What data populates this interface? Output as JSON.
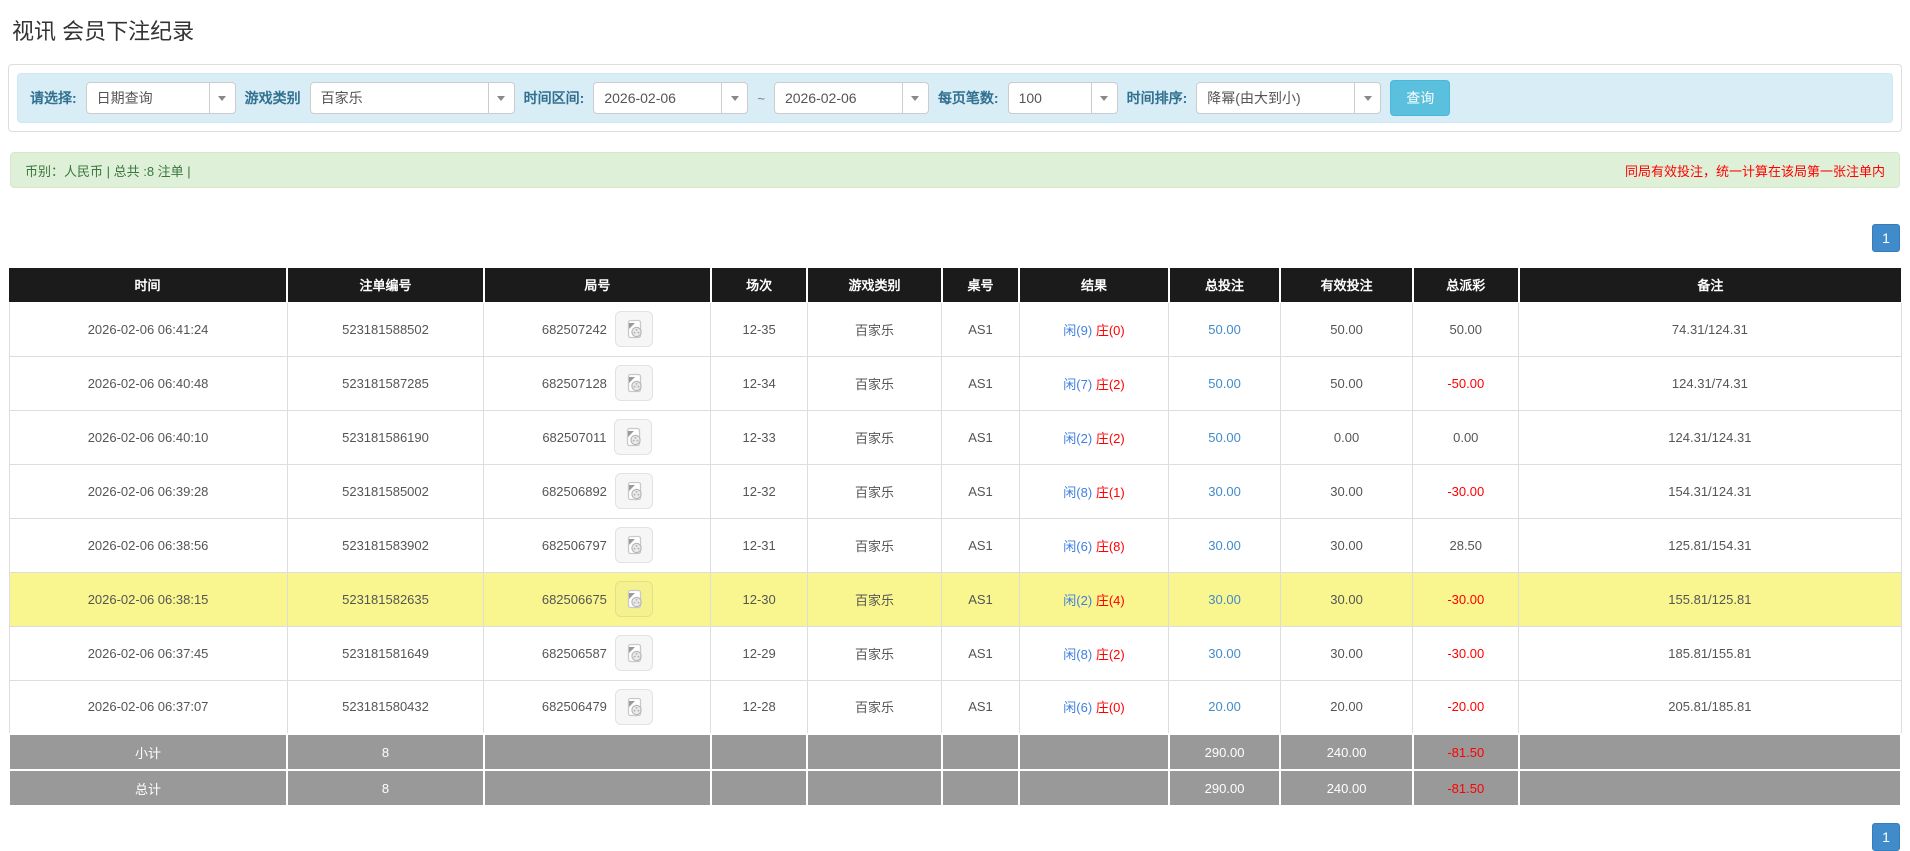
{
  "page": {
    "title": "视讯 会员下注纪录"
  },
  "filters": {
    "select_label": "请选择:",
    "select_value": "日期查询",
    "game_type_label": "游戏类别",
    "game_type_value": "百家乐",
    "date_range_label": "时间区间:",
    "date_from": "2026-02-06",
    "date_separator": "~",
    "date_to": "2026-02-06",
    "page_size_label": "每页笔数:",
    "page_size_value": "100",
    "sort_label": "时间排序:",
    "sort_value": "降幂(由大到小)",
    "search_button": "查询"
  },
  "alert_bar": {
    "left_text": "币别：人民币 | 总共 :8 注单 |",
    "right_text": "同局有效投注，统一计算在该局第一张注单内"
  },
  "pagination": {
    "page": "1"
  },
  "colors": {
    "accent_blue": "#428bca",
    "button_blue": "#5bc0de",
    "player_blue": "#3e7fe0",
    "loss_red": "#ff0000",
    "highlight_yellow": "#f9f690",
    "summary_gray": "#999999",
    "header_black": "#1b1b1b",
    "alert_green_bg": "#dff0d8",
    "filter_blue_bg": "#d9edf7"
  },
  "table": {
    "headers": [
      "时间",
      "注单编号",
      "局号",
      "场次",
      "游戏类别",
      "桌号",
      "结果",
      "总投注",
      "有效投注",
      "总派彩",
      "备注"
    ],
    "rows": [
      {
        "time": "2026-02-06 06:41:24",
        "bet_no": "523181588502",
        "round_no": "682507242",
        "session": "12-35",
        "game": "百家乐",
        "table_no": "AS1",
        "player": "闲(9)",
        "banker": "庄(0)",
        "total_bet": "50.00",
        "valid_bet": "50.00",
        "payout": "50.00",
        "note": "74.31/124.31",
        "highlight": false
      },
      {
        "time": "2026-02-06 06:40:48",
        "bet_no": "523181587285",
        "round_no": "682507128",
        "session": "12-34",
        "game": "百家乐",
        "table_no": "AS1",
        "player": "闲(7)",
        "banker": "庄(2)",
        "total_bet": "50.00",
        "valid_bet": "50.00",
        "payout": "-50.00",
        "note": "124.31/74.31",
        "highlight": false
      },
      {
        "time": "2026-02-06 06:40:10",
        "bet_no": "523181586190",
        "round_no": "682507011",
        "session": "12-33",
        "game": "百家乐",
        "table_no": "AS1",
        "player": "闲(2)",
        "banker": "庄(2)",
        "total_bet": "50.00",
        "valid_bet": "0.00",
        "payout": "0.00",
        "note": "124.31/124.31",
        "highlight": false
      },
      {
        "time": "2026-02-06 06:39:28",
        "bet_no": "523181585002",
        "round_no": "682506892",
        "session": "12-32",
        "game": "百家乐",
        "table_no": "AS1",
        "player": "闲(8)",
        "banker": "庄(1)",
        "total_bet": "30.00",
        "valid_bet": "30.00",
        "payout": "-30.00",
        "note": "154.31/124.31",
        "highlight": false
      },
      {
        "time": "2026-02-06 06:38:56",
        "bet_no": "523181583902",
        "round_no": "682506797",
        "session": "12-31",
        "game": "百家乐",
        "table_no": "AS1",
        "player": "闲(6)",
        "banker": "庄(8)",
        "total_bet": "30.00",
        "valid_bet": "30.00",
        "payout": "28.50",
        "note": "125.81/154.31",
        "highlight": false
      },
      {
        "time": "2026-02-06 06:38:15",
        "bet_no": "523181582635",
        "round_no": "682506675",
        "session": "12-30",
        "game": "百家乐",
        "table_no": "AS1",
        "player": "闲(2)",
        "banker": "庄(4)",
        "total_bet": "30.00",
        "valid_bet": "30.00",
        "payout": "-30.00",
        "note": "155.81/125.81",
        "highlight": true
      },
      {
        "time": "2026-02-06 06:37:45",
        "bet_no": "523181581649",
        "round_no": "682506587",
        "session": "12-29",
        "game": "百家乐",
        "table_no": "AS1",
        "player": "闲(8)",
        "banker": "庄(2)",
        "total_bet": "30.00",
        "valid_bet": "30.00",
        "payout": "-30.00",
        "note": "185.81/155.81",
        "highlight": false
      },
      {
        "time": "2026-02-06 06:37:07",
        "bet_no": "523181580432",
        "round_no": "682506479",
        "session": "12-28",
        "game": "百家乐",
        "table_no": "AS1",
        "player": "闲(6)",
        "banker": "庄(0)",
        "total_bet": "20.00",
        "valid_bet": "20.00",
        "payout": "-20.00",
        "note": "205.81/185.81",
        "highlight": false
      }
    ],
    "subtotal": {
      "label": "小计",
      "count": "8",
      "total_bet": "290.00",
      "valid_bet": "240.00",
      "payout": "-81.50"
    },
    "total": {
      "label": "总计",
      "count": "8",
      "total_bet": "290.00",
      "valid_bet": "240.00",
      "payout": "-81.50"
    }
  }
}
